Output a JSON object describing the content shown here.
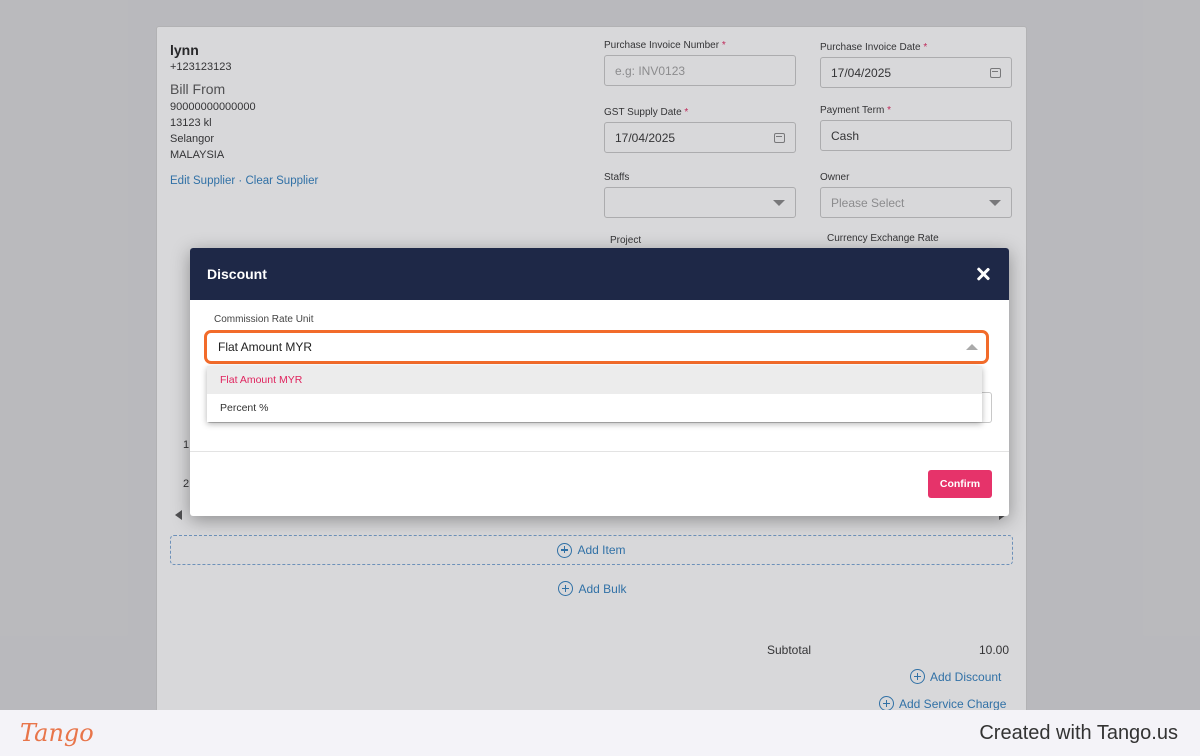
{
  "supplier": {
    "name": "lynn",
    "phone": "+123123123",
    "bill_from_label": "Bill From",
    "line1": "90000000000000",
    "line2": "13123 kl",
    "line3": "Selangor",
    "line4": "MALAYSIA",
    "edit_link": "Edit Supplier",
    "separator": " · ",
    "clear_link": "Clear Supplier"
  },
  "form": {
    "invoice_number": {
      "label": "Purchase Invoice Number",
      "placeholder": "e.g: INV0123"
    },
    "invoice_date": {
      "label": "Purchase Invoice Date",
      "value": "17/04/2025"
    },
    "gst_date": {
      "label": "GST Supply Date",
      "value": "17/04/2025"
    },
    "payment_term": {
      "label": "Payment Term",
      "value": "Cash"
    },
    "staffs": {
      "label": "Staffs",
      "value": ""
    },
    "owner": {
      "label": "Owner",
      "placeholder": "Please Select"
    },
    "project": {
      "label": "Project"
    },
    "currency_rate": {
      "label": "Currency Exchange Rate"
    },
    "required_mark": "*"
  },
  "items": {
    "row_numbers": [
      "1",
      "2"
    ],
    "add_item": "Add Item",
    "add_bulk": "Add Bulk"
  },
  "totals": {
    "subtotal_label": "Subtotal",
    "subtotal_value": "10.00",
    "add_discount": "Add Discount",
    "add_service_charge": "Add Service Charge"
  },
  "modal": {
    "title": "Discount",
    "field_label": "Commission Rate Unit",
    "selected_value": "Flat Amount MYR",
    "options": [
      "Flat Amount MYR",
      "Percent %"
    ],
    "confirm_label": "Confirm"
  },
  "footer": {
    "logo_text": "Tango",
    "created_text": "Created with Tango.us"
  },
  "colors": {
    "modal_header": "#1e2847",
    "highlight": "#f26b2a",
    "accent": "#e6336a",
    "link": "#2f7fbf"
  }
}
